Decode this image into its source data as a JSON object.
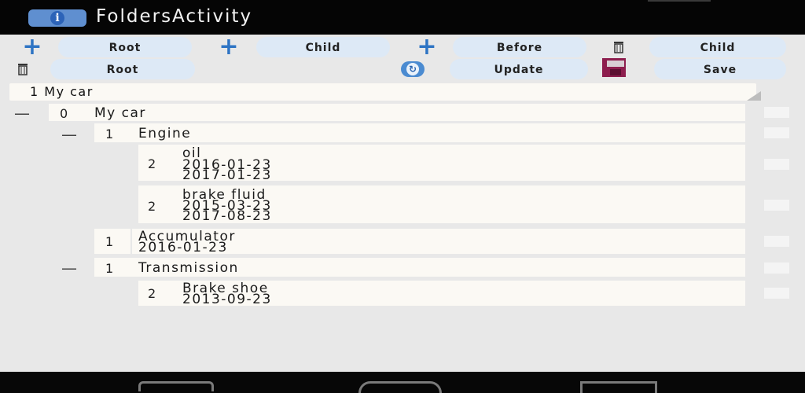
{
  "app": {
    "title": "FoldersActivity",
    "icon": "info-icon"
  },
  "toolbar": {
    "add_root": "Root",
    "add_child": "Child",
    "add_before": "Before",
    "delete_child": "Child",
    "delete_root": "Root",
    "update": "Update",
    "save": "Save"
  },
  "selector": {
    "value": "1 My car"
  },
  "tree": {
    "root": {
      "level": "0",
      "name": "My car",
      "toggle": "—"
    },
    "engine": {
      "level": "1",
      "name": "Engine",
      "toggle": "—"
    },
    "oil": {
      "level": "2",
      "name": "oil",
      "date1": "2016-01-23",
      "date2": "2017-01-23"
    },
    "brake_fluid": {
      "level": "2",
      "name": "brake fluid",
      "date1": "2015-03-23",
      "date2": "2017-08-23"
    },
    "accumulator": {
      "level": "1",
      "name": "Accumulator",
      "date1": "2016-01-23"
    },
    "transmission": {
      "level": "1",
      "name": "Transmission",
      "toggle": "—"
    },
    "brake_shoe": {
      "level": "2",
      "name": "Brake shoe",
      "date1": "2013-09-23"
    }
  },
  "navbar": {
    "back": "back-icon",
    "home": "home-icon",
    "recent": "recent-apps-icon"
  }
}
